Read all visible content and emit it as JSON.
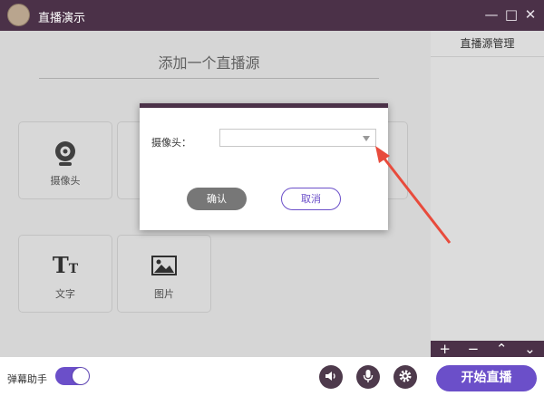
{
  "app": {
    "title": "直播演示"
  },
  "window_controls": {
    "minimize": "—",
    "maximize": "□",
    "close": "✕"
  },
  "main": {
    "title": "添加一个直播源",
    "tiles": [
      {
        "label": "摄像头",
        "icon": "webcam-icon"
      },
      {
        "label": "文字",
        "icon": "text-tt-icon"
      },
      {
        "label": "图片",
        "icon": "image-icon"
      }
    ],
    "text_icon_glyph": {
      "big": "T",
      "small": "T"
    }
  },
  "right_panel": {
    "title": "直播源管理",
    "tools": {
      "add": "+",
      "remove": "−",
      "up": "⌃",
      "down": "⌄"
    }
  },
  "bottom": {
    "danmu_label": "弹幕助手",
    "danmu_enabled": true,
    "start_label": "开始直播"
  },
  "dialog": {
    "camera_label": "摄像头：",
    "camera_value": "",
    "ok_label": "确认",
    "cancel_label": "取消"
  },
  "colors": {
    "accent": "#6b4fc9",
    "titlebar": "#4b3148",
    "annotation": "#e84b3c"
  }
}
